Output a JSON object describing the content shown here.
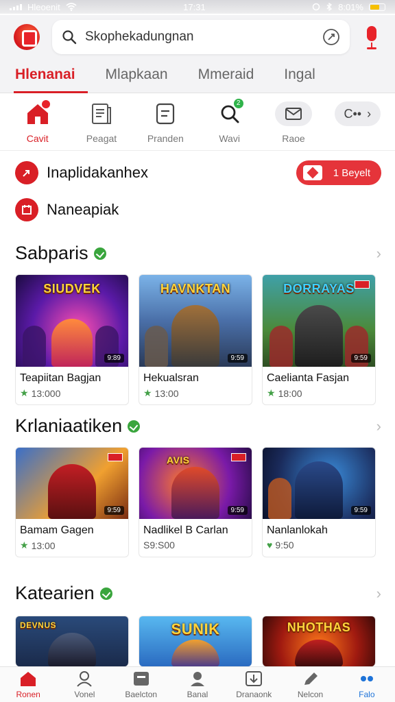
{
  "status_bar": {
    "carrier": "Hleoenit",
    "time": "17:31",
    "battery": "8:01%"
  },
  "header": {
    "search_placeholder": "Skophekadungnan"
  },
  "tabs": [
    {
      "label": "Hlenanai",
      "active": true
    },
    {
      "label": "Mlapkaan",
      "active": false
    },
    {
      "label": "Mmeraid",
      "active": false
    },
    {
      "label": "Ingal",
      "active": false
    }
  ],
  "quick_actions": [
    {
      "label": "Cavit",
      "icon": "home-icon"
    },
    {
      "label": "Peagat",
      "icon": "document-icon"
    },
    {
      "label": "Pranden",
      "icon": "receipt-icon"
    },
    {
      "label": "Wavi",
      "icon": "search-icon",
      "badge": "2"
    },
    {
      "label": "Raoe",
      "icon": "mail-icon"
    },
    {
      "label": "C••",
      "icon": "more-icon"
    }
  ],
  "promos": [
    {
      "text": "Inaplidakanhex",
      "button": "1 Beyelt"
    },
    {
      "text": "Naneapiak"
    }
  ],
  "sections": [
    {
      "title": "Sabparis",
      "items": [
        {
          "name": "Teapiitan Bagjan",
          "price": "13:000",
          "thumb_title": "SIUDVEK",
          "stamp": "9:89"
        },
        {
          "name": "Hekualsran",
          "price": "13:00",
          "thumb_title": "HAVNKTAN",
          "stamp": "9:59"
        },
        {
          "name": "Caelianta Fasjan",
          "price": "18:00",
          "thumb_title": "DORRAYAS",
          "stamp": "9:59"
        }
      ]
    },
    {
      "title": "Krlaniaatiken",
      "items": [
        {
          "name": "Bamam Gagen",
          "price": "13:00",
          "thumb_title": "",
          "stamp": "9:59"
        },
        {
          "name": "Nadlikel B Carlan",
          "price": "S9:S00",
          "thumb_title": "AVIS",
          "stamp": "9:59"
        },
        {
          "name": "Nanlanlokah",
          "price": "9:50",
          "thumb_title": "",
          "stamp": "9:59"
        }
      ]
    },
    {
      "title": "Katearien",
      "items": [
        {
          "name": "",
          "price": "",
          "thumb_title": "DEVNUS",
          "stamp": ""
        },
        {
          "name": "",
          "price": "",
          "thumb_title": "SUNIK",
          "stamp": ""
        },
        {
          "name": "",
          "price": "",
          "thumb_title": "NHOTHAS",
          "stamp": ""
        }
      ]
    }
  ],
  "bottom_nav": [
    {
      "label": "Ronen",
      "icon": "home-icon"
    },
    {
      "label": "Vonel",
      "icon": "person-icon"
    },
    {
      "label": "Baelcton",
      "icon": "tablet-icon"
    },
    {
      "label": "Banal",
      "icon": "profile-icon"
    },
    {
      "label": "Dranaonk",
      "icon": "download-icon"
    },
    {
      "label": "Nelcon",
      "icon": "pen-icon"
    },
    {
      "label": "Falo",
      "icon": "more-icon"
    }
  ],
  "colors": {
    "accent": "#d91f26",
    "verified": "#3aa53d",
    "link": "#1e73d8"
  }
}
